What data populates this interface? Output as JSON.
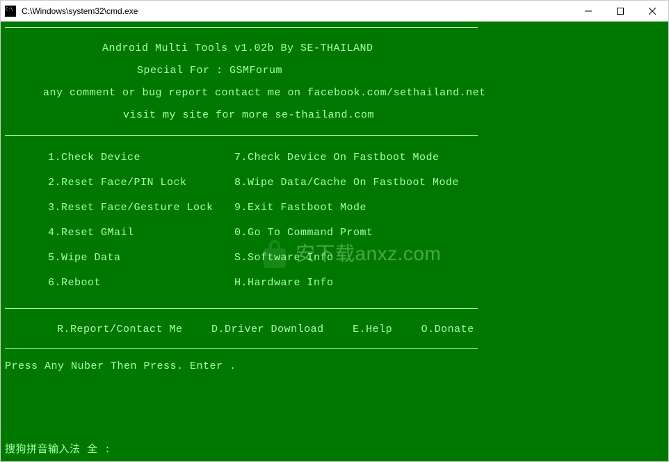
{
  "titlebar": {
    "title": "C:\\Windows\\system32\\cmd.exe"
  },
  "header": {
    "title": "Android Multi Tools v1.02b By SE-THAILAND",
    "special": "Special For : GSMForum",
    "contact": "any comment or bug report contact me on facebook.com/sethailand.net",
    "visit": "visit my site for more se-thailand.com"
  },
  "menu": {
    "left": [
      "1.Check Device",
      "2.Reset Face/PIN Lock",
      "3.Reset Face/Gesture Lock",
      "4.Reset GMail",
      "5.Wipe Data",
      "6.Reboot"
    ],
    "right": [
      "7.Check Device On Fastboot Mode",
      "8.Wipe Data/Cache On Fastboot Mode",
      "9.Exit Fastboot Mode",
      "0.Go To Command Promt",
      "S.Software Info",
      "H.Hardware Info"
    ]
  },
  "bottom": {
    "report": "R.Report/Contact Me",
    "driver": "D.Driver Download",
    "help": "E.Help",
    "donate": "O.Donate"
  },
  "prompt": "Press Any Nuber Then Press. Enter  .",
  "ime": "搜狗拼音输入法 全 :",
  "watermark": "安下载anxz.com"
}
